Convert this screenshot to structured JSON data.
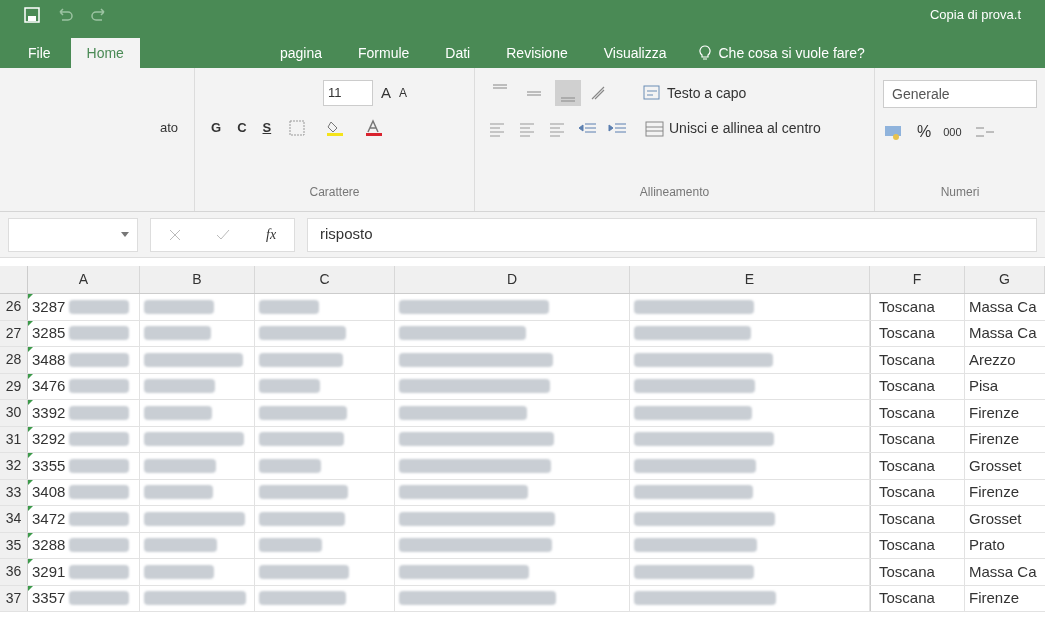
{
  "title_bar": {
    "title": "Copia di prova.t"
  },
  "tabs": [
    {
      "label": "File",
      "selected": false
    },
    {
      "label": "Home",
      "selected": true
    },
    {
      "label": "pagina",
      "selected": false
    },
    {
      "label": "Formule",
      "selected": false
    },
    {
      "label": "Dati",
      "selected": false
    },
    {
      "label": "Revisione",
      "selected": false
    },
    {
      "label": "Visualizza",
      "selected": false
    }
  ],
  "tell_me": "Che cosa si vuole fare?",
  "ribbon": {
    "clipboard_fragment": "ato",
    "font_size": "11",
    "grow_font": "A",
    "shrink_font": "A",
    "font_buttons": [
      "G",
      "C",
      "S"
    ],
    "font_group": "Carattere",
    "vertical_align": [
      {
        "kind": "top",
        "selected": false
      },
      {
        "kind": "middle",
        "selected": false
      },
      {
        "kind": "bottom",
        "selected": true
      }
    ],
    "wrap_text": "Testo a capo",
    "merge": "Unisci e allinea al centro",
    "alignment_group": "Allineamento",
    "number_format": "Generale",
    "percent": "%",
    "thousands": "000",
    "number_group": "Numeri"
  },
  "formula_bar": {
    "fx": "fx",
    "value": "risposto"
  },
  "columns": [
    "A",
    "B",
    "C",
    "D",
    "E",
    "F",
    "G"
  ],
  "rows": [
    {
      "number": "26",
      "column_a": "3287",
      "column_f": "Toscana",
      "column_g": "Massa Ca"
    },
    {
      "number": "27",
      "column_a": "3285",
      "column_f": "Toscana",
      "column_g": "Massa Ca"
    },
    {
      "number": "28",
      "column_a": "3488",
      "column_f": "Toscana",
      "column_g": "Arezzo"
    },
    {
      "number": "29",
      "column_a": "3476",
      "column_f": "Toscana",
      "column_g": "Pisa"
    },
    {
      "number": "30",
      "column_a": "3392",
      "column_f": "Toscana",
      "column_g": "Firenze"
    },
    {
      "number": "31",
      "column_a": "3292",
      "column_f": "Toscana",
      "column_g": "Firenze"
    },
    {
      "number": "32",
      "column_a": "3355",
      "column_f": "Toscana",
      "column_g": "Grosset"
    },
    {
      "number": "33",
      "column_a": "3408",
      "column_f": "Toscana",
      "column_g": "Firenze"
    },
    {
      "number": "34",
      "column_a": "3472",
      "column_f": "Toscana",
      "column_g": "Grosset"
    },
    {
      "number": "35",
      "column_a": "3288",
      "column_f": "Toscana",
      "column_g": "Prato"
    },
    {
      "number": "36",
      "column_a": "3291",
      "column_f": "Toscana",
      "column_g": "Massa Ca"
    },
    {
      "number": "37",
      "column_a": "3357",
      "column_f": "Toscana",
      "column_g": "Firenze"
    }
  ]
}
